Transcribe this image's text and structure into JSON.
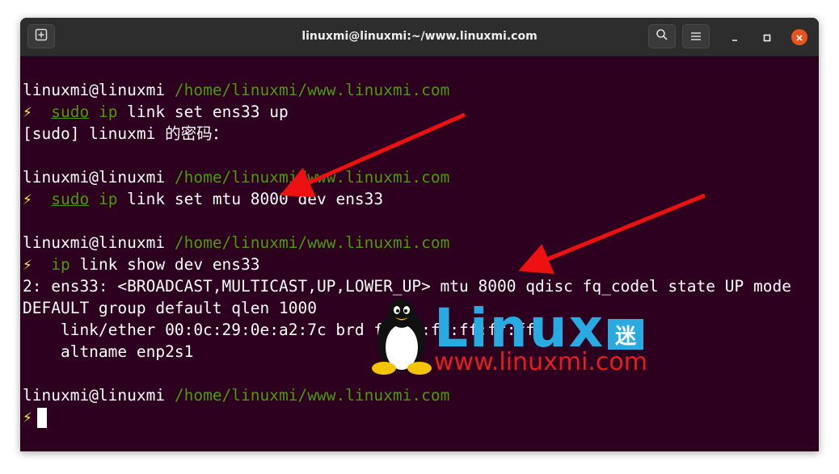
{
  "window": {
    "title": "linuxmi@linuxmi:~/www.linuxmi.com",
    "colors": {
      "terminal_bg": "#2c001e",
      "path_green": "#4e9a06",
      "bolt_yellow": "#fce94f",
      "close_orange": "#e95420",
      "arrow_red": "#ee1111"
    }
  },
  "icons": {
    "new_tab": "new-tab-icon",
    "search": "search-icon",
    "menu": "hamburger-menu-icon",
    "minimize": "minimize-icon",
    "maximize": "maximize-icon",
    "close": "close-icon"
  },
  "terminal": {
    "user_host": "linuxmi@linuxmi",
    "cwd": "/home/linuxmi/www.linuxmi.com",
    "prompt_symbol": "⚡",
    "cmd1": {
      "sudo": "sudo",
      "ip": "ip",
      "rest": " link set ens33 up"
    },
    "sudo_prompt": "[sudo] linuxmi 的密码：",
    "cmd2": {
      "sudo": "sudo",
      "ip": "ip",
      "rest": " link set mtu 8000 dev ens33"
    },
    "cmd3": {
      "ip": "ip",
      "rest": " link show dev ens33"
    },
    "output": [
      "2: ens33: <BROADCAST,MULTICAST,UP,LOWER_UP> mtu 8000 qdisc fq_codel state UP mode",
      "DEFAULT group default qlen 1000",
      "    link/ether 00:0c:29:0e:a2:7c brd ff:ff:ff:ff:ff:ff",
      "    altname enp2s1"
    ]
  },
  "watermark": {
    "brand": "Linux",
    "brand_cn": "迷",
    "url": "www.linuxmi.com"
  }
}
